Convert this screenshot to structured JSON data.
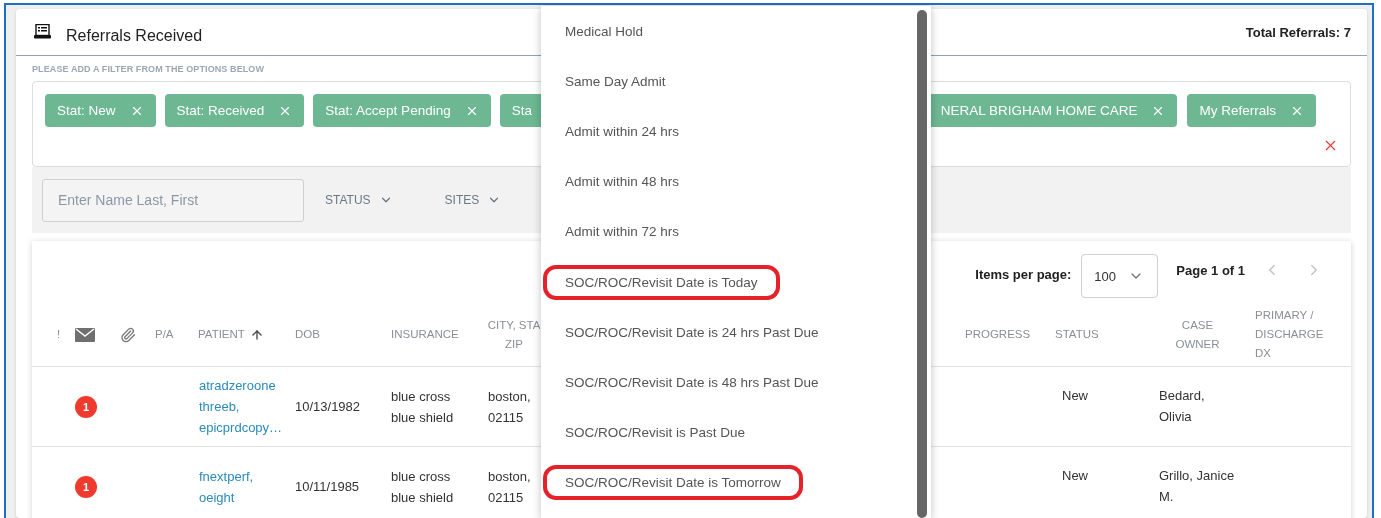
{
  "header": {
    "title": "Referrals Received",
    "total": "Total Referrals: 7"
  },
  "filter_hint": "PLEASE ADD A FILTER FROM THE OPTIONS BELOW",
  "filter_chips": {
    "left": [
      {
        "label": "Stat: New",
        "truncated": false
      },
      {
        "label": "Stat: Received",
        "truncated": false
      },
      {
        "label": "Stat: Accept Pending",
        "truncated": false
      },
      {
        "label": "Sta",
        "truncated": true
      }
    ],
    "right": [
      {
        "label": "NERAL BRIGHAM HOME CARE",
        "truncated": true
      },
      {
        "label": "My Referrals",
        "truncated": false
      }
    ]
  },
  "search": {
    "placeholder": "Enter Name Last, First"
  },
  "filters": [
    {
      "label": "STATUS"
    },
    {
      "label": "SITES"
    }
  ],
  "pagination": {
    "items_label": "Items per page:",
    "per_page": "100",
    "page": "Page 1 of 1"
  },
  "table": {
    "columns": [
      {
        "kind": "text",
        "label": "!",
        "sorted": false
      },
      {
        "kind": "mail"
      },
      {
        "kind": "clip"
      },
      {
        "kind": "text",
        "label": "P/A",
        "sorted": false
      },
      {
        "kind": "text",
        "label": "PATIENT",
        "sorted": true
      },
      {
        "kind": "text",
        "label": "DOB",
        "sorted": false
      },
      {
        "kind": "text",
        "label": "INSURANCE",
        "sorted": false
      },
      {
        "kind": "text",
        "label": "CITY, STA\nZIP",
        "sorted": false
      },
      {
        "kind": "text",
        "label": "PROGRESS",
        "sorted": false
      },
      {
        "kind": "text",
        "label": "STATUS",
        "sorted": false
      },
      {
        "kind": "text",
        "label": "CASE\nOWNER",
        "sorted": false
      },
      {
        "kind": "text",
        "label": "PRIMARY /\nDISCHARGE\nDX",
        "sorted": false
      }
    ],
    "rows": [
      {
        "notifications": "1",
        "patient": "atradzeroone\nthreeb,\nepicprdcopy…",
        "dob": "10/13/1982",
        "insurance": "blue cross\nblue shield",
        "city": "boston,\n02115",
        "status": "New",
        "case_owner": "Bedard,\nOlivia"
      },
      {
        "notifications": "1",
        "patient": "fnextperf,\noeight",
        "dob": "10/11/1985",
        "insurance": "blue cross\nblue shield",
        "city": "boston,\n02115",
        "status": "New",
        "case_owner": "Grillo, Janice\nM."
      }
    ]
  },
  "dropdown": {
    "items": [
      {
        "label": "Medical Hold",
        "circled": false
      },
      {
        "label": "Same Day Admit",
        "circled": false
      },
      {
        "label": "Admit within 24 hrs",
        "circled": false
      },
      {
        "label": "Admit within 48 hrs",
        "circled": false
      },
      {
        "label": "Admit within 72 hrs",
        "circled": false
      },
      {
        "label": "SOC/ROC/Revisit Date is Today",
        "circled": true
      },
      {
        "label": "SOC/ROC/Revisit Date is 24 hrs Past Due",
        "circled": false
      },
      {
        "label": "SOC/ROC/Revisit Date is 48 hrs Past Due",
        "circled": false
      },
      {
        "label": "SOC/ROC/Revisit is Past Due",
        "circled": false
      },
      {
        "label": "SOC/ROC/Revisit Date is Tomorrow",
        "circled": true
      }
    ]
  }
}
